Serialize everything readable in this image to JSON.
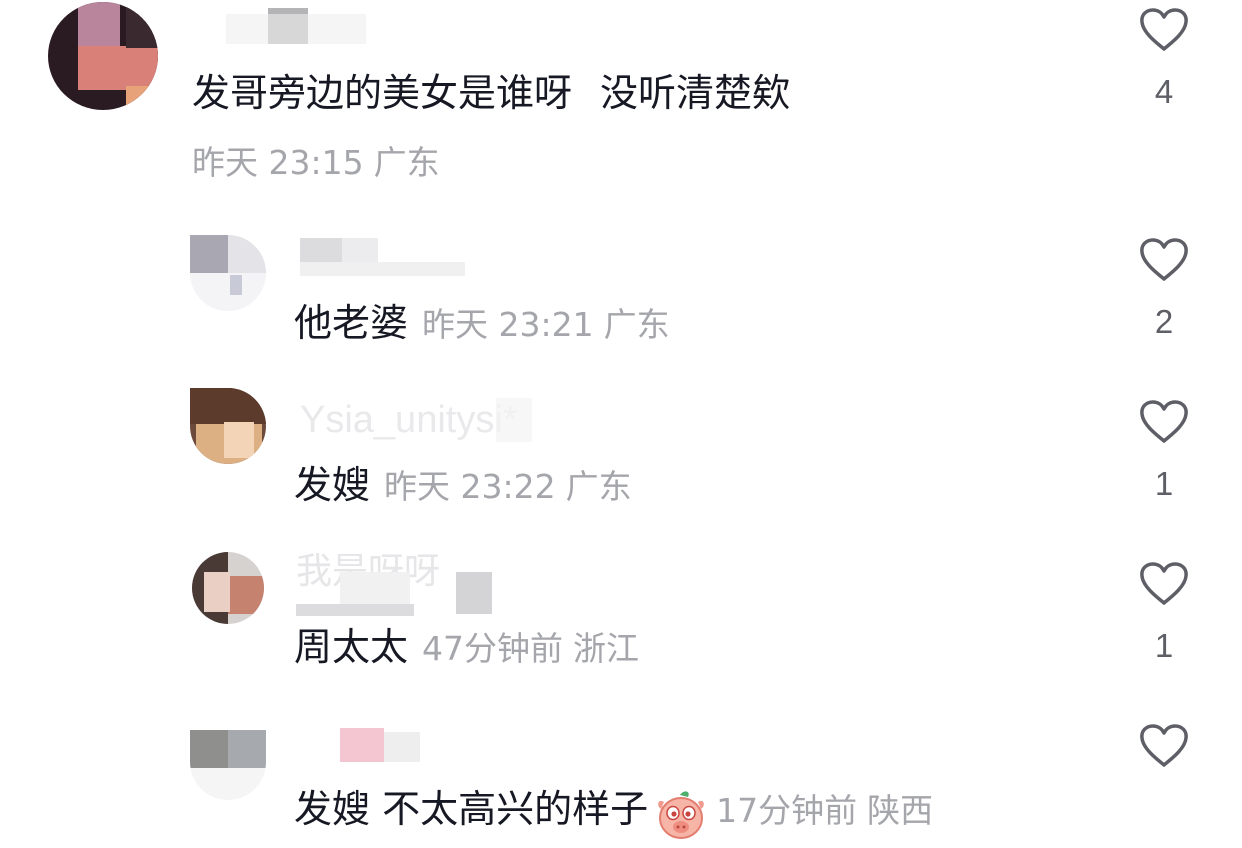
{
  "comments": [
    {
      "text": "发哥旁边的美女是谁呀",
      "text2": "没听清楚欸",
      "meta": {
        "time": "昨天 23:15",
        "location": "广东"
      },
      "likes": "4"
    },
    {
      "text": "他老婆",
      "meta": {
        "time": "昨天 23:21",
        "location": "广东"
      },
      "likes": "2"
    },
    {
      "username": "Ysia_unitysi*",
      "text": "发嫂",
      "meta": {
        "time": "昨天 23:22",
        "location": "广东"
      },
      "likes": "1"
    },
    {
      "username": "我是呀呀",
      "text": "周太太",
      "meta": {
        "time": "47分钟前",
        "location": "浙江"
      },
      "likes": "1"
    },
    {
      "text": "发嫂 不太高兴的样子",
      "emoji": "pig-face-emoji",
      "meta": {
        "time": "17分钟前",
        "location": "陕西"
      },
      "likes": ""
    }
  ],
  "icons": {
    "like": "heart-outline-icon"
  },
  "colors": {
    "text": "#161823",
    "meta": "#a5a6ab",
    "like_icon": "#5e5f66"
  }
}
